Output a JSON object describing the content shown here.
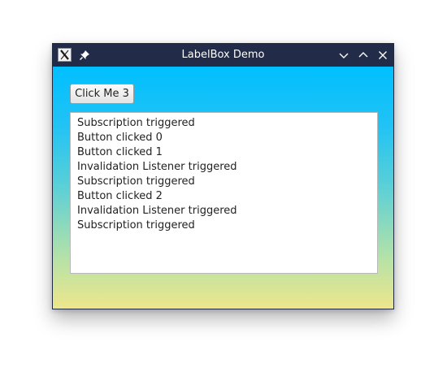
{
  "window": {
    "title": "LabelBox Demo"
  },
  "icons": {
    "app": "x-window-icon",
    "pin": "pin-icon",
    "minimize": "chevron-down-icon",
    "maximize": "chevron-up-icon",
    "close": "close-icon"
  },
  "toolbar": {
    "click_label": "Click Me 3"
  },
  "log": {
    "items": [
      "Subscription triggered",
      "Button clicked 0",
      "Button clicked 1",
      "Invalidation Listener triggered",
      "Subscription triggered",
      "Button clicked 2",
      "Invalidation Listener triggered",
      "Subscription triggered"
    ]
  },
  "colors": {
    "titlebar": "#222b47",
    "gradient_top": "#00bfff",
    "gradient_bottom": "#eee68c"
  }
}
